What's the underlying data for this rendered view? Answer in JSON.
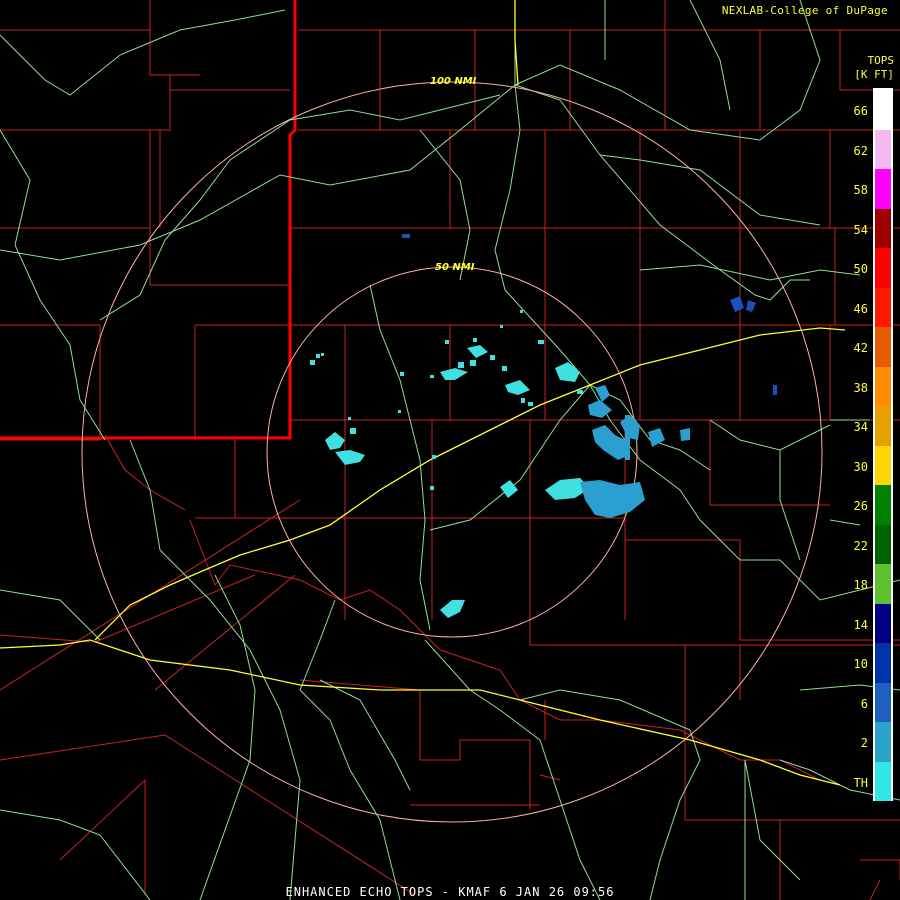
{
  "header": {
    "credit": "NEXLAB-College of DuPage",
    "legend_title_line1": "TOPS",
    "legend_title_line2": "[K FT]"
  },
  "rings": [
    {
      "label": "100 NMI"
    },
    {
      "label": "50 NMI"
    }
  ],
  "caption": "ENHANCED ECHO TOPS - KMAF 6 JAN 26 09:56",
  "legend": {
    "labels": [
      "66",
      "62",
      "58",
      "54",
      "50",
      "46",
      "42",
      "38",
      "34",
      "30",
      "26",
      "22",
      "18",
      "14",
      "10",
      "6",
      "2",
      "TH"
    ],
    "colors": [
      "#ffffff",
      "#f5b8f0",
      "#ff00ff",
      "#a00000",
      "#ff0000",
      "#ff1a00",
      "#e65c00",
      "#ff8c00",
      "#e6a000",
      "#ffd700",
      "#008000",
      "#006400",
      "#5fbf2f",
      "#000080",
      "#0033aa",
      "#1f5fbf",
      "#2aa3c8",
      "#30e6e6"
    ]
  },
  "colors": {
    "county_lines": "#cc2222",
    "state_line": "#ff0000",
    "roads": "#8fe08f",
    "highways": "#ffff33",
    "rings": "#ffb0a0",
    "echo_light": "#40e0e0",
    "echo_mid": "#2a9fd0",
    "echo_dark": "#1e4fbf"
  }
}
